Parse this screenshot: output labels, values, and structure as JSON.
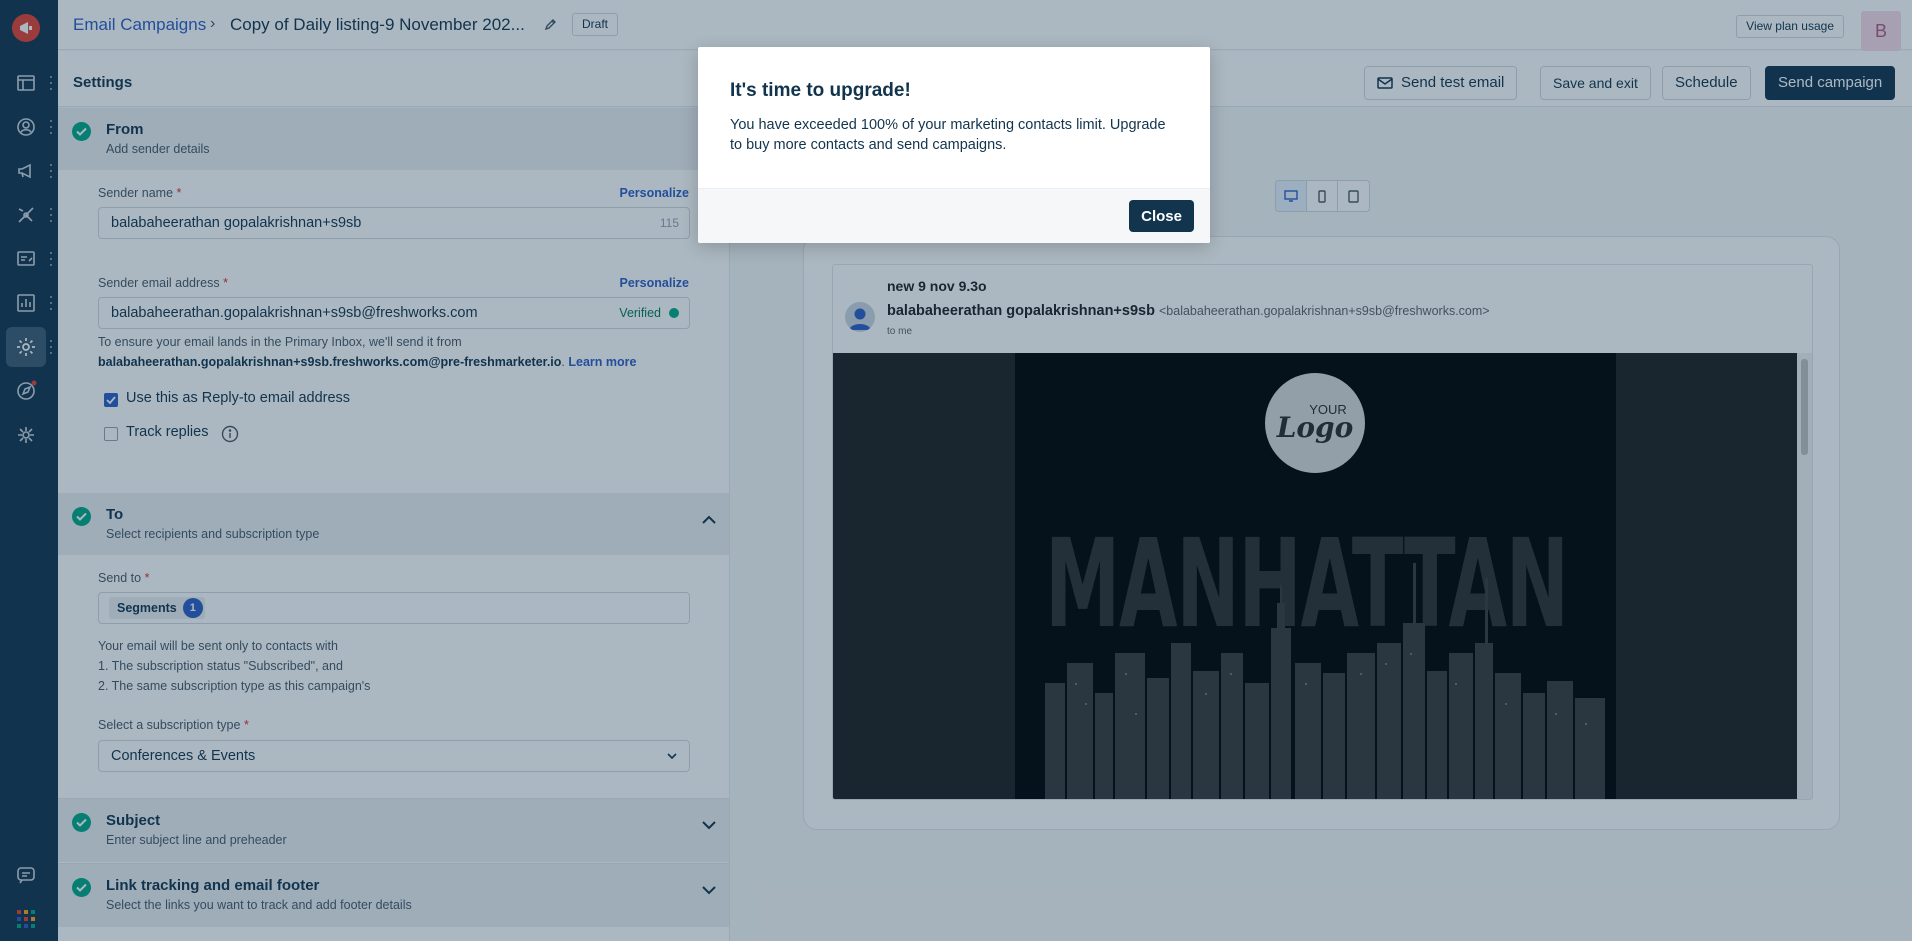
{
  "header": {
    "breadcrumb_root": "Email Campaigns",
    "separator": "›",
    "campaign_title": "Copy of Daily listing-9 November 202...",
    "status_badge": "Draft",
    "plan_usage_label": "View plan usage",
    "avatar_initial": "B"
  },
  "subheader": {
    "title": "Settings",
    "send_test_label": "Send test email",
    "save_exit_label": "Save and exit",
    "schedule_label": "Schedule",
    "send_campaign_label": "Send campaign"
  },
  "from_section": {
    "title": "From",
    "subtitle": "Add sender details",
    "sender_name_label": "Sender name",
    "sender_name_value": "balabaheerathan gopalakrishnan+s9sb",
    "sender_name_count": "115",
    "personalize_label": "Personalize",
    "sender_email_label": "Sender email address",
    "sender_email_value": "balabaheerathan.gopalakrishnan+s9sb@freshworks.com",
    "verified_label": "Verified",
    "help_prefix": "To ensure your email lands in the Primary Inbox, we'll send it from",
    "help_address": "balabaheerathan.gopalakrishnan+s9sb.freshworks.com@pre-freshmarketer.io",
    "help_link": "Learn more",
    "reply_to_label": "Use this as Reply-to email address",
    "track_replies_label": "Track replies"
  },
  "to_section": {
    "title": "To",
    "subtitle": "Select recipients and subscription type",
    "send_to_label": "Send to",
    "segments_chip": "Segments",
    "segments_count": "1",
    "info_line1": "Your email will be sent only to contacts with",
    "info_line2": "1. The subscription status \"Subscribed\", and",
    "info_line3": "2. The same subscription type as this campaign's",
    "subscription_type_label": "Select a subscription type",
    "subscription_type_value": "Conferences & Events"
  },
  "subject_section": {
    "title": "Subject",
    "subtitle": "Enter subject line and preheader"
  },
  "link_section": {
    "title": "Link tracking and email footer",
    "subtitle": "Select the links you want to track and add footer details"
  },
  "preview": {
    "subject": "new 9 nov 9.3o",
    "from_name": "balabaheerathan gopalakrishnan+s9sb",
    "from_email": "<balabaheerathan.gopalakrishnan+s9sb@freshworks.com>",
    "to_line": "to me",
    "logo_top": "YOUR",
    "logo_main": "Logo",
    "hero_text": "MANHATTAN"
  },
  "modal": {
    "title": "It's time to upgrade!",
    "body": "You have exceeded 100% of your marketing contacts limit. Upgrade to buy more contacts and send campaigns.",
    "close_label": "Close"
  },
  "colors": {
    "rail": "#12344d",
    "accent_blue": "#2c5cc5",
    "success_green": "#00a886",
    "primary_button": "#12344d"
  }
}
